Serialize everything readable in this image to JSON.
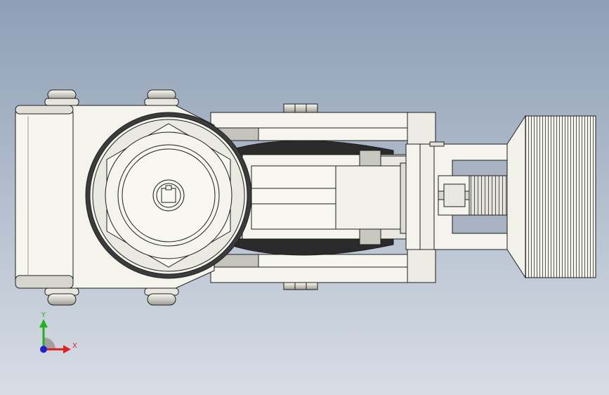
{
  "app": {
    "view": "cad-3d-viewport"
  },
  "colors": {
    "bg_top": "#8e9fb6",
    "bg_bottom": "#d6dbe3",
    "part_fill": "#f4f4ec",
    "part_stroke": "#1e1e1e",
    "shade": "#b8b8b0",
    "dark": "#3a3a3a",
    "x_axis": "#e02020",
    "y_axis": "#20b020",
    "z_axis": "#2020d0"
  },
  "triad": {
    "x_label": "X",
    "y_label": "Y"
  },
  "icons": [
    "triad-icon"
  ]
}
